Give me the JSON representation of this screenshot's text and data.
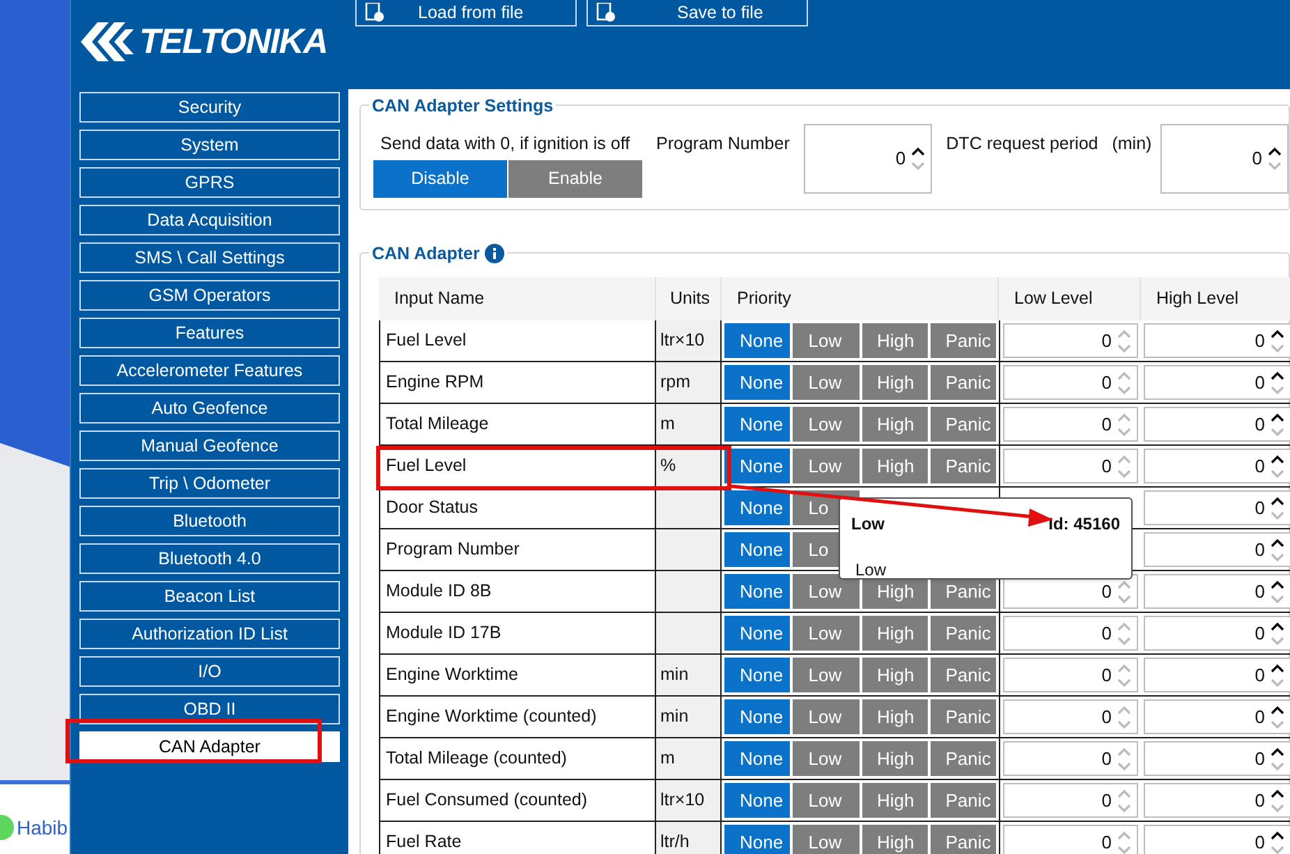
{
  "browser": {
    "user_name": "Habib"
  },
  "logo": {
    "text": "TELTONIKA"
  },
  "toolbar": {
    "buttons": [
      "Load from file",
      "Save to file"
    ]
  },
  "sidebar": {
    "items": [
      {
        "label": "Security",
        "selected": false
      },
      {
        "label": "System",
        "selected": false
      },
      {
        "label": "GPRS",
        "selected": false
      },
      {
        "label": "Data Acquisition",
        "selected": false
      },
      {
        "label": "SMS \\ Call Settings",
        "selected": false
      },
      {
        "label": "GSM Operators",
        "selected": false
      },
      {
        "label": "Features",
        "selected": false
      },
      {
        "label": "Accelerometer Features",
        "selected": false
      },
      {
        "label": "Auto Geofence",
        "selected": false
      },
      {
        "label": "Manual Geofence",
        "selected": false
      },
      {
        "label": "Trip \\ Odometer",
        "selected": false
      },
      {
        "label": "Bluetooth",
        "selected": false
      },
      {
        "label": "Bluetooth 4.0",
        "selected": false
      },
      {
        "label": "Beacon List",
        "selected": false
      },
      {
        "label": "Authorization ID List",
        "selected": false
      },
      {
        "label": "I/O",
        "selected": false
      },
      {
        "label": "OBD II",
        "selected": false
      },
      {
        "label": "CAN Adapter",
        "selected": true
      }
    ]
  },
  "settings": {
    "title": "CAN Adapter Settings",
    "ignition_label": "Send data with 0, if ignition is off",
    "ignition_options": [
      {
        "label": "Disable",
        "selected": true
      },
      {
        "label": "Enable",
        "selected": false
      }
    ],
    "program_number": {
      "label": "Program Number",
      "value": "0"
    },
    "dtc": {
      "label": "DTC request period",
      "unit": "(min)",
      "value": "0"
    }
  },
  "table": {
    "title": "CAN Adapter",
    "columns": [
      "Input Name",
      "Units",
      "Priority",
      "Low Level",
      "High Level"
    ],
    "rows": [
      {
        "name": "Fuel Level",
        "units": "ltr×10",
        "priority": [
          {
            "label": "None",
            "selected": true
          },
          {
            "label": "Low",
            "selected": false
          },
          {
            "label": "High",
            "selected": false
          },
          {
            "label": "Panic",
            "selected": false
          }
        ],
        "low_level": "0",
        "high_level": "0"
      },
      {
        "name": "Engine RPM",
        "units": "rpm",
        "priority": [
          {
            "label": "None",
            "selected": true
          },
          {
            "label": "Low",
            "selected": false
          },
          {
            "label": "High",
            "selected": false
          },
          {
            "label": "Panic",
            "selected": false
          }
        ],
        "low_level": "0",
        "high_level": "0"
      },
      {
        "name": "Total Mileage",
        "units": "m",
        "priority": [
          {
            "label": "None",
            "selected": true
          },
          {
            "label": "Low",
            "selected": false
          },
          {
            "label": "High",
            "selected": false
          },
          {
            "label": "Panic",
            "selected": false
          }
        ],
        "low_level": "0",
        "high_level": "0"
      },
      {
        "name": "Fuel Level",
        "units": "%",
        "priority": [
          {
            "label": "None",
            "selected": true
          },
          {
            "label": "Low",
            "selected": false
          },
          {
            "label": "High",
            "selected": false
          },
          {
            "label": "Panic",
            "selected": false
          }
        ],
        "low_level": "0",
        "high_level": "0"
      },
      {
        "name": "Door Status",
        "priority": [
          {
            "label": "None",
            "selected": true
          },
          {
            "label": "Lo",
            "selected": false
          }
        ],
        "high_level": "0"
      },
      {
        "name": "Program Number",
        "priority": [
          {
            "label": "None",
            "selected": true
          },
          {
            "label": "Lo",
            "selected": false
          }
        ],
        "high_level": "0"
      },
      {
        "name": "Module ID 8B",
        "priority": [
          {
            "label": "None",
            "selected": true
          },
          {
            "label": "Low",
            "selected": false
          },
          {
            "label": "High",
            "selected": false
          },
          {
            "label": "Panic",
            "selected": false
          }
        ],
        "low_level": "0",
        "high_level": "0"
      },
      {
        "name": "Module ID 17B",
        "priority": [
          {
            "label": "None",
            "selected": true
          },
          {
            "label": "Low",
            "selected": false
          },
          {
            "label": "High",
            "selected": false
          },
          {
            "label": "Panic",
            "selected": false
          }
        ],
        "low_level": "0",
        "high_level": "0"
      },
      {
        "name": "Engine Worktime",
        "units": "min",
        "priority": [
          {
            "label": "None",
            "selected": true
          },
          {
            "label": "Low",
            "selected": false
          },
          {
            "label": "High",
            "selected": false
          },
          {
            "label": "Panic",
            "selected": false
          }
        ],
        "low_level": "0",
        "high_level": "0"
      },
      {
        "name": "Engine Worktime (counted)",
        "units": "min",
        "priority": [
          {
            "label": "None",
            "selected": true
          },
          {
            "label": "Low",
            "selected": false
          },
          {
            "label": "High",
            "selected": false
          },
          {
            "label": "Panic",
            "selected": false
          }
        ],
        "low_level": "0",
        "high_level": "0"
      },
      {
        "name": "Total Mileage (counted)",
        "units": "m",
        "priority": [
          {
            "label": "None",
            "selected": true
          },
          {
            "label": "Low",
            "selected": false
          },
          {
            "label": "High",
            "selected": false
          },
          {
            "label": "Panic",
            "selected": false
          }
        ],
        "low_level": "0",
        "high_level": "0"
      },
      {
        "name": "Fuel Consumed (counted)",
        "units": "ltr×10",
        "priority": [
          {
            "label": "None",
            "selected": true
          },
          {
            "label": "Low",
            "selected": false
          },
          {
            "label": "High",
            "selected": false
          },
          {
            "label": "Panic",
            "selected": false
          }
        ],
        "low_level": "0",
        "high_level": "0"
      },
      {
        "name": "Fuel Rate",
        "units": "ltr/h",
        "priority": [
          {
            "label": "None",
            "selected": true
          },
          {
            "label": "Low",
            "selected": false
          },
          {
            "label": "High",
            "selected": false
          },
          {
            "label": "Panic",
            "selected": false
          }
        ],
        "low_level": "0",
        "high_level": "0"
      }
    ]
  },
  "tooltip": {
    "title": "Low",
    "id": "Id: 45160",
    "text": "Low"
  }
}
